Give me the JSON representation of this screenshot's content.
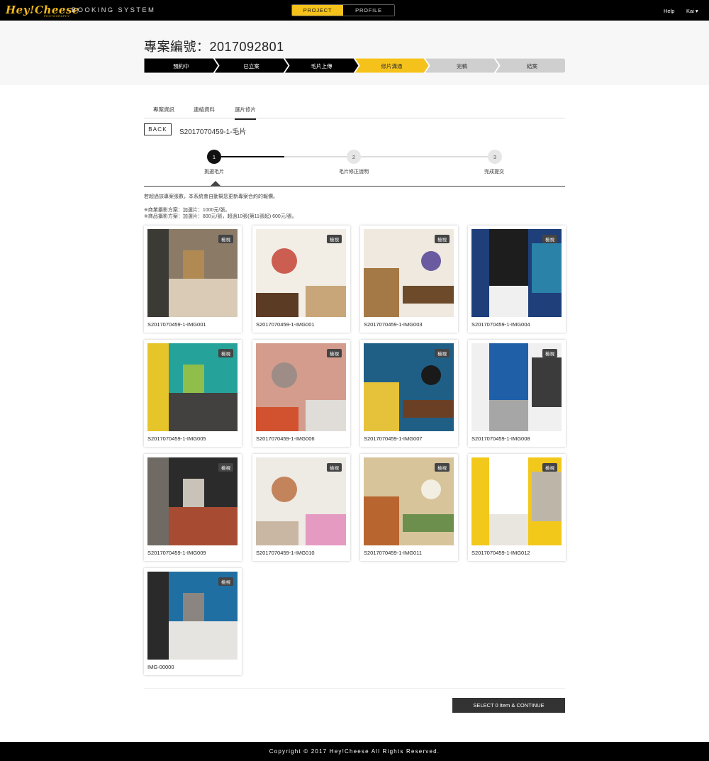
{
  "topbar": {
    "logo": "Hey!Cheese",
    "logo_sub": "PHOTOGRAPHY",
    "brand": "BOOKING SYSTEM",
    "toggle": [
      "PROJECT",
      "PROFILE"
    ],
    "help": "Help",
    "user": "Kai ▾"
  },
  "header": {
    "title": "專案編號：2017092801",
    "steps": [
      {
        "label": "預約中",
        "state": "done"
      },
      {
        "label": "已立案",
        "state": "done"
      },
      {
        "label": "毛片上傳",
        "state": "done"
      },
      {
        "label": "修片溝通",
        "state": "active"
      },
      {
        "label": "完稿",
        "state": "todo"
      },
      {
        "label": "結案",
        "state": "todo"
      }
    ]
  },
  "tabs": [
    "專案資訊",
    "連絡資料",
    "選片修片"
  ],
  "back_label": "BACK",
  "file_title": "S2017070459-1-毛片",
  "progress": {
    "steps": [
      {
        "num": "1",
        "label": "挑選毛片"
      },
      {
        "num": "2",
        "label": "毛片修正說明"
      },
      {
        "num": "3",
        "label": "完成提交"
      }
    ]
  },
  "notice": {
    "line1": "若超過該專案張數，本系統會自動幫您更新專案合約的報價。",
    "line2": "※商業攝影方案：加選片：1000元/張。",
    "line3": "※商品攝影方案：加選片：800元/張，超過10張(第11張起) 600元/張。"
  },
  "view_label": "檢視",
  "images": [
    {
      "caption": "S2017070459-1-IMG001",
      "palette": [
        "#8b7a66",
        "#d9cbb6",
        "#3c3a35",
        "#b08a52"
      ]
    },
    {
      "caption": "S2017070459-1-IMG001",
      "palette": [
        "#f2eee6",
        "#c9a679",
        "#5c3b24",
        "#c23a2c"
      ]
    },
    {
      "caption": "S2017070459-1-IMG003",
      "palette": [
        "#efe9df",
        "#a57946",
        "#6d4a2a",
        "#6a5aa0"
      ]
    },
    {
      "caption": "S2017070459-1-IMG004",
      "palette": [
        "#1e3f7a",
        "#1d1d1d",
        "#f0f0f0",
        "#2a82a8"
      ]
    },
    {
      "caption": "S2017070459-1-IMG005",
      "palette": [
        "#25a39a",
        "#43413f",
        "#e5c52a",
        "#8fbf4a"
      ]
    },
    {
      "caption": "S2017070459-1-IMG006",
      "palette": [
        "#d49c8c",
        "#e0ddd9",
        "#d2522f",
        "#8e8a84"
      ]
    },
    {
      "caption": "S2017070459-1-IMG007",
      "palette": [
        "#1f5f86",
        "#e6c23a",
        "#6b3f24",
        "#1a1a1a"
      ]
    },
    {
      "caption": "S2017070459-1-IMG008",
      "palette": [
        "#f0f0f0",
        "#1f5fa8",
        "#a6a6a6",
        "#3b3b3b"
      ]
    },
    {
      "caption": "S2017070459-1-IMG009",
      "palette": [
        "#2b2b2b",
        "#a84b33",
        "#6f6a63",
        "#c9c2b8"
      ]
    },
    {
      "caption": "S2017070459-1-IMG010",
      "palette": [
        "#eeeae4",
        "#e59ac2",
        "#c9b7a4",
        "#b86a3a"
      ]
    },
    {
      "caption": "S2017070459-1-IMG011",
      "palette": [
        "#d8c49a",
        "#b8652f",
        "#6c8f4e",
        "#f2eee2"
      ]
    },
    {
      "caption": "S2017070459-1-IMG012",
      "palette": [
        "#f2c81a",
        "#ffffff",
        "#e9e6df",
        "#bdb6a8"
      ]
    },
    {
      "caption": "IMG-00000",
      "palette": [
        "#1f6fa3",
        "#e6e4e0",
        "#2a2a2a",
        "#8a8580"
      ]
    }
  ],
  "continue_label": "SELECT 0 Item & CONTINUE",
  "footer": "Copyright © 2017 Hey!Cheese All Rights Reserved.",
  "colors": {
    "accent": "#f4c21a",
    "dark": "#000000",
    "pending": "#cfcfcf"
  }
}
